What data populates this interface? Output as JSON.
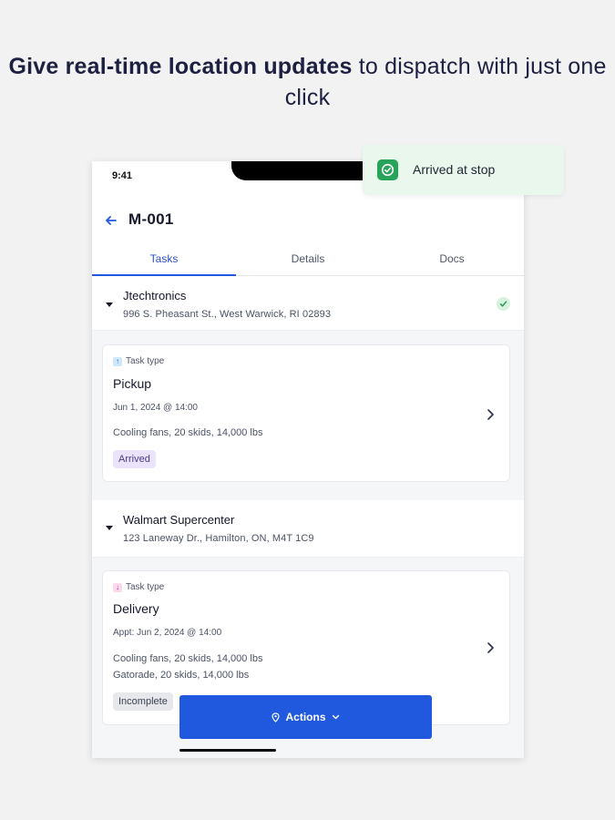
{
  "headline": {
    "bold": "Give real-time location updates",
    "rest": " to dispatch with just one click"
  },
  "statusbar": {
    "time": "9:41"
  },
  "header": {
    "title": "M-001"
  },
  "tabs": [
    {
      "label": "Tasks",
      "active": true
    },
    {
      "label": "Details",
      "active": false
    },
    {
      "label": "Docs",
      "active": false
    }
  ],
  "stops": [
    {
      "name": "Jtechtronics",
      "address": "996 S. Pheasant St., West Warwick, RI 02893",
      "completed": true,
      "task": {
        "type_label": "Task type",
        "type_icon": "arrow-up-icon",
        "name": "Pickup",
        "date": "Jun 1, 2024 @ 14:00",
        "cargo": [
          "Cooling fans, 20 skids, 14,000 lbs"
        ],
        "status": "Arrived"
      }
    },
    {
      "name": "Walmart Supercenter",
      "address": "123 Laneway Dr., Hamilton, ON, M4T 1C9",
      "completed": false,
      "task": {
        "type_label": "Task type",
        "type_icon": "arrow-down-icon",
        "name": "Delivery",
        "date_prefix": "Appt:",
        "date": "Jun 2, 2024 @ 14:00",
        "cargo": [
          "Cooling fans, 20 skids, 14,000 lbs",
          "Gatorade, 20 skids, 14,000 lbs"
        ],
        "status": "Incomplete"
      }
    }
  ],
  "actions_button": {
    "label": "Actions",
    "icon": "location-pin-icon"
  },
  "toast": {
    "text": "Arrived at stop",
    "icon": "check-circle-icon"
  },
  "colors": {
    "accent": "#2059de",
    "tab_active": "#2454e0",
    "success": "#27a35a",
    "toast_bg": "#e9f7ec",
    "badge_arrived_bg": "#ebe3fb",
    "badge_incomplete_bg": "#e6e8ec"
  }
}
